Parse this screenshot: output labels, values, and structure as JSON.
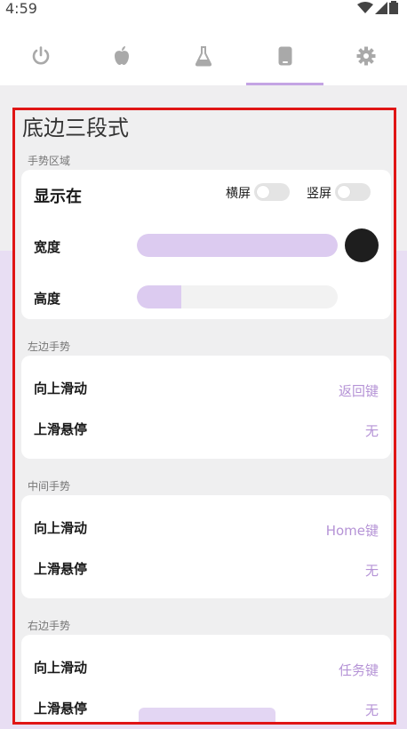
{
  "status_bar": {
    "time": "4:59",
    "icons": [
      "wifi-icon",
      "signal-icon",
      "battery-icon"
    ]
  },
  "tabs": [
    {
      "name": "power",
      "icon": "power-icon",
      "active": false
    },
    {
      "name": "apple",
      "icon": "apple-icon",
      "active": false
    },
    {
      "name": "lab",
      "icon": "flask-icon",
      "active": false
    },
    {
      "name": "phone",
      "icon": "phone-icon",
      "active": true
    },
    {
      "name": "settings",
      "icon": "gear-icon",
      "active": false
    }
  ],
  "page": {
    "title": "底边三段式",
    "gesture_area": {
      "section_label": "手势区域",
      "show_on_label": "显示在",
      "landscape_label": "横屏",
      "portrait_label": "竖屏",
      "width_label": "宽度",
      "width_fraction": 1.0,
      "height_label": "高度",
      "height_fraction": 0.22,
      "color": "#1e1e1e"
    },
    "left_gesture": {
      "section_label": "左边手势",
      "swipe_up_label": "向上滑动",
      "swipe_up_value": "返回键",
      "hover_label": "上滑悬停",
      "hover_value": "无"
    },
    "middle_gesture": {
      "section_label": "中间手势",
      "swipe_up_label": "向上滑动",
      "swipe_up_value": "Home键",
      "hover_label": "上滑悬停",
      "hover_value": "无"
    },
    "right_gesture": {
      "section_label": "右边手势",
      "swipe_up_label": "向上滑动",
      "swipe_up_value": "任务键",
      "hover_label": "上滑悬停",
      "hover_value": "无"
    }
  },
  "colors": {
    "accent": "#b593d6",
    "accent_light": "#dccbf0",
    "highlight_border": "#e01515"
  }
}
